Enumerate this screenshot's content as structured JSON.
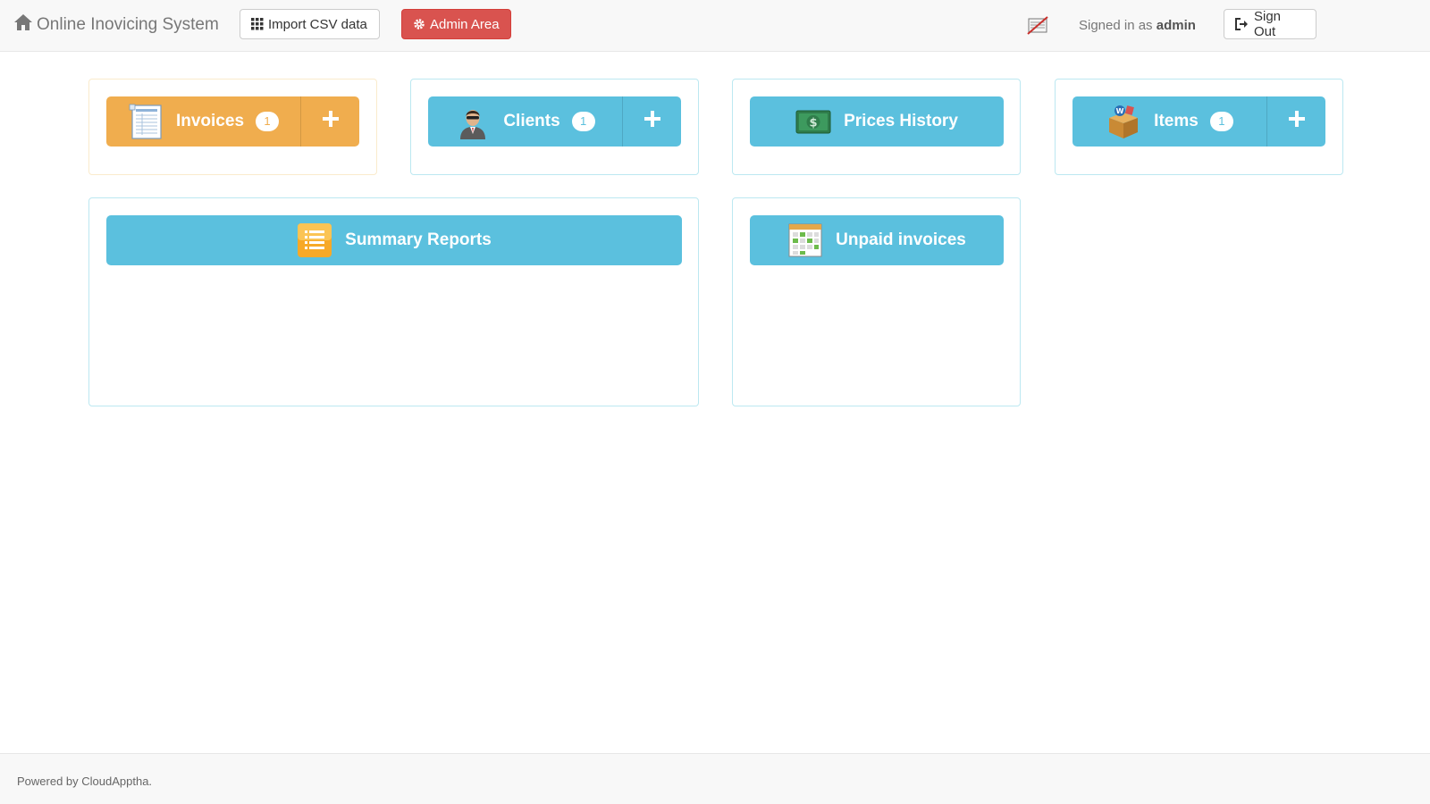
{
  "navbar": {
    "brand": "Online Inovicing System",
    "import_label": "Import CSV data",
    "admin_label": "Admin Area",
    "signed_prefix": "Signed in as",
    "username": "admin",
    "signout_label": "Sign Out"
  },
  "tiles": {
    "invoices": {
      "label": "Invoices",
      "count": "1",
      "add": "+"
    },
    "clients": {
      "label": "Clients",
      "count": "1",
      "add": "+"
    },
    "prices_history": {
      "label": "Prices History"
    },
    "items": {
      "label": "Items",
      "count": "1",
      "add": "+"
    },
    "summary_reports": {
      "label": "Summary Reports"
    },
    "unpaid_invoices": {
      "label": "Unpaid invoices"
    }
  },
  "footer": {
    "text": "Powered by CloudApptha."
  },
  "colors": {
    "info": "#5bc0de",
    "warning": "#f0ad4e",
    "danger": "#d9534f"
  }
}
